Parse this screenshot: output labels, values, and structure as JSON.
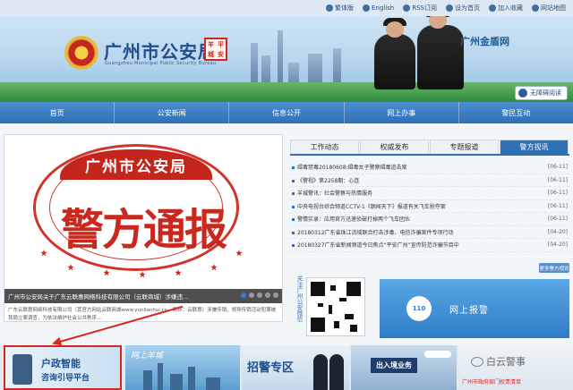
{
  "topbar": {
    "items": [
      "繁体版",
      "English",
      "RSS订阅",
      "设为首页",
      "加入收藏",
      "网站地图"
    ]
  },
  "header": {
    "title": "广州市公安局",
    "subtitle": "Guangzhou Municipal Public Security Bureau",
    "seal_chars": [
      "羊",
      "平",
      "城",
      "安"
    ],
    "net_name": "广州金盾网",
    "accessible": "无障碍阅读"
  },
  "nav": {
    "items": [
      "首页",
      "公安新闻",
      "信息公开",
      "网上办事",
      "警民互动"
    ]
  },
  "hero": {
    "ribbon": "广州市公安局",
    "headline": "警方通报",
    "caption": "广州市公安局关于广东云联惠网络科技有限公司（云联商城）涉嫌违...",
    "description": "广东云联惠网络科技有限公司（其官方网站云联商城www.yunlianhui.cn，简称：云联惠）涉嫌传销，领导传销活动犯罪被我局立案调查，为依法维护社会公共秩序...",
    "slide_count": 5,
    "active_slide": 0
  },
  "tabs": {
    "items": [
      "工作动态",
      "权威发布",
      "专题报道",
      "警方视讯"
    ],
    "active": 3
  },
  "news": [
    {
      "title": "缉毒禁毒20180608:缉毒女子警察缉毒追击案",
      "date": "[06-11]"
    },
    {
      "title": "《警视》第2258期：心连",
      "date": "[06-11]"
    },
    {
      "title": "羊城警讯：社会警察与热情服务",
      "date": "[06-11]"
    },
    {
      "title": "中央电视台综合频道CCTV-1《朝闻天下》报道有关飞车抢夺案",
      "date": "[06-11]"
    },
    {
      "title": "警情实录：应用官方迅速侦破打掉两个飞车团伙",
      "date": "[06-11]"
    },
    {
      "title": "20180312广东省珠江流域联合打击涉毒、电信诈骗案件专项行动",
      "date": "[04-20]"
    },
    {
      "title": "20180327广东省新闻频道今日焦点“平安广州”宣传防范诈骗节目中",
      "date": "[04-20]"
    }
  ],
  "more_label": "更多警方视讯",
  "follow_label": "关注广州公安微信",
  "report": {
    "icon_text": "110",
    "label": "网上报警"
  },
  "bottom_banners": {
    "policy_line1": "户政智能",
    "policy_line2": "咨询引导平台",
    "scenic_script": "网上羊城",
    "recruit": "招警专区",
    "entry_exit": "出入境业务",
    "watermark": "白云警事",
    "footer_line": "广州市政府部门权责清单"
  },
  "colors": {
    "primary": "#2f6fb4",
    "accent_red": "#d7261e",
    "nav_gradient_top": "#4c8ed0"
  }
}
